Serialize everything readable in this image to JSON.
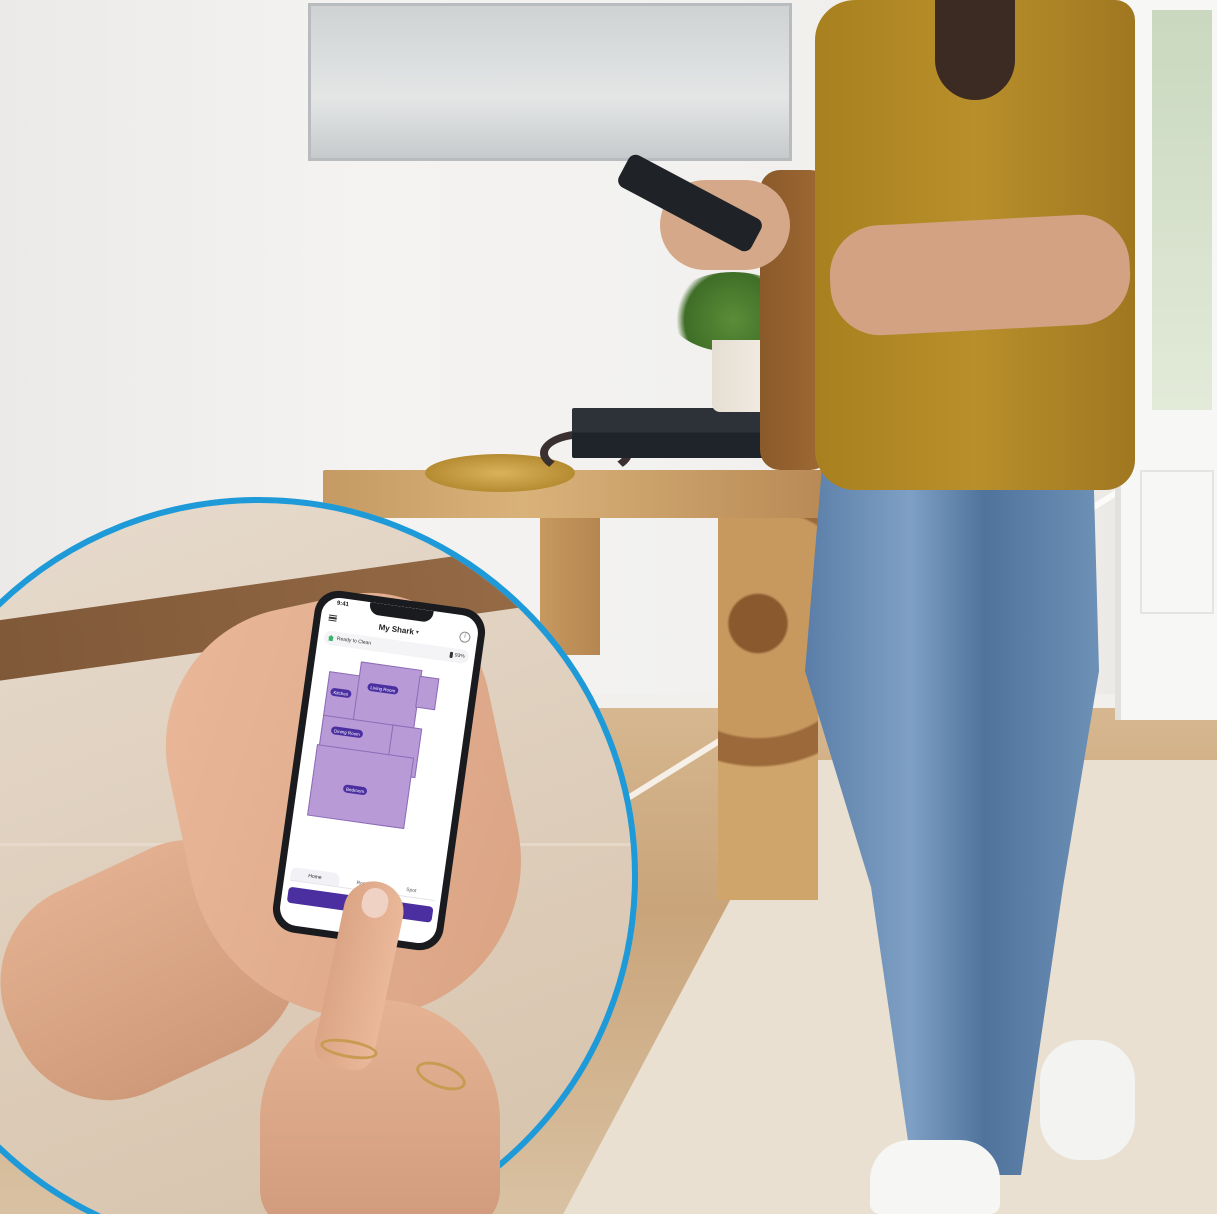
{
  "phone_app": {
    "status_time": "9:41",
    "title": "My Shark",
    "status_text": "Ready to Clean",
    "battery_level": "93%",
    "rooms": [
      "Kitchen",
      "Living Room",
      "Dining Room",
      "Bedroom"
    ],
    "tabs": [
      "Home",
      "Room",
      "Spot"
    ],
    "clean_button_label": "C"
  },
  "colors": {
    "accent_ring": "#1f9ad8",
    "app_primary": "#4b2fa0",
    "map_room": "#b79ad6"
  }
}
